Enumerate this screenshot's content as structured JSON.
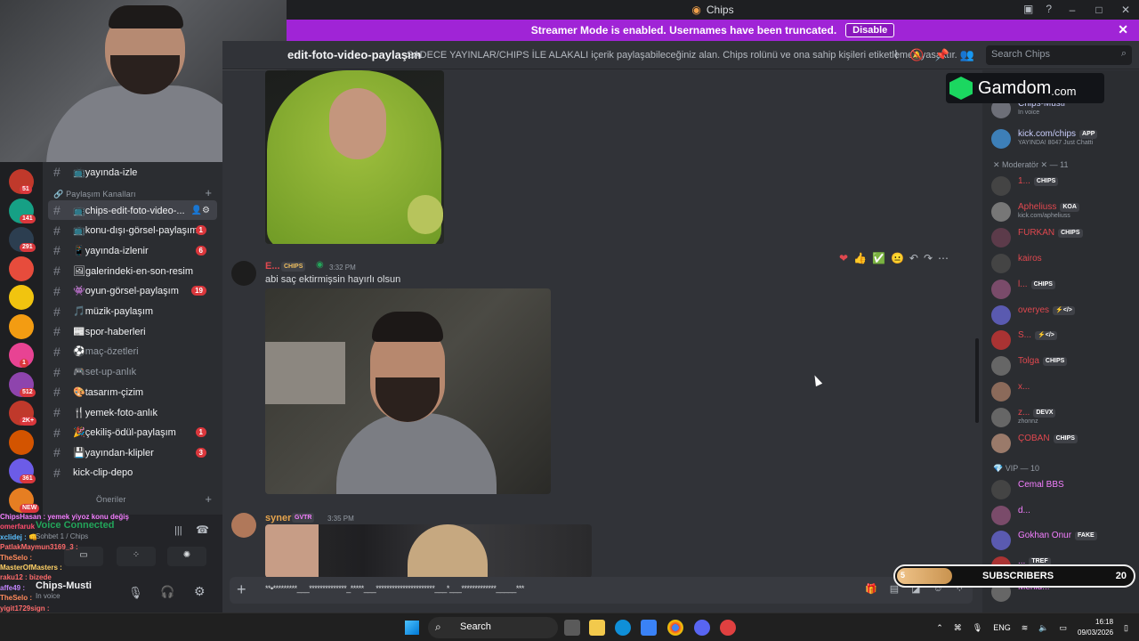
{
  "window": {
    "title": "Chips"
  },
  "banner": {
    "text": "Streamer Mode is enabled. Usernames have been truncated.",
    "disable_label": "Disable"
  },
  "header": {
    "channel_name": "edit-foto-video-paylaşım",
    "topic": "SADECE YAYINLAR/CHIPS İLE ALAKALI içerik paylaşabileceğiniz alan. Chips rolünü ve ona sahip kişileri etiketlemek yasaktır.",
    "search_placeholder": "Search Chips"
  },
  "servers": [
    {
      "badge": "51",
      "color": "#c0392b"
    },
    {
      "badge": "141",
      "color": "#16a085"
    },
    {
      "badge": "291",
      "color": "#2c3e50"
    },
    {
      "badge": "",
      "color": "#e74c3c"
    },
    {
      "badge": "",
      "color": "#f1c40f"
    },
    {
      "badge": "",
      "color": "#f39c12"
    },
    {
      "badge": "1",
      "color": "#e84393"
    },
    {
      "badge": "512",
      "color": "#8e44ad"
    },
    {
      "badge": "2K+",
      "color": "#c0392b"
    },
    {
      "badge": "",
      "color": "#d35400"
    },
    {
      "badge": "361",
      "color": "#6c5ce7"
    },
    {
      "badge": "NEW",
      "color": "#e67e22"
    }
  ],
  "channels": {
    "top_item": "📺yayında-izle",
    "category": "🔗 Paylaşım Kanalları",
    "items": [
      {
        "label": "📺chips-edit-foto-video-...",
        "count": "",
        "state": "sel"
      },
      {
        "label": "📺konu-dışı-görsel-paylaşım",
        "count": "1",
        "state": "unread"
      },
      {
        "label": "📱yayında-izlenir",
        "count": "6",
        "state": "unread"
      },
      {
        "label": "🖼galerindeki-en-son-resim",
        "count": "",
        "state": "unread"
      },
      {
        "label": "👾oyun-görsel-paylaşım",
        "count": "19",
        "state": "unread"
      },
      {
        "label": "🎵müzik-paylaşım",
        "count": "",
        "state": "unread"
      },
      {
        "label": "📰spor-haberleri",
        "count": "",
        "state": "unread"
      },
      {
        "label": "⚽maç-özetleri",
        "count": "",
        "state": "read"
      },
      {
        "label": "🎮set-up-anlık",
        "count": "",
        "state": "read"
      },
      {
        "label": "🎨tasarım-çizim",
        "count": "",
        "state": "unread"
      },
      {
        "label": "🍴yemek-foto-anlık",
        "count": "",
        "state": "unread"
      },
      {
        "label": "🎉çekiliş-ödül-paylaşım",
        "count": "1",
        "state": "unread"
      },
      {
        "label": "💾yayından-klipler",
        "count": "3",
        "state": "unread"
      },
      {
        "label": "kick-clip-depo",
        "count": "",
        "state": "unread"
      }
    ],
    "category2": "Öneriler"
  },
  "voice": {
    "status": "Voice Connected",
    "channel": "Sohbet 1 / Chips",
    "user": "Chips-Musti",
    "user_status": "In voice"
  },
  "chat_overlay": [
    "ChipsHasan : yemek yiyoz konu değiş",
    "omerfaruk",
    "xclidej : 👊",
    "PatlakMaymun3169_3 :",
    "TheSelo :",
    "MasterOfMasters :",
    "raku12 : bizede",
    "affe49 :",
    "TheSelo :",
    "yigit1729sign :"
  ],
  "messages": [
    {
      "user": "E...",
      "tag": "CHIPS",
      "time": "3:32 PM",
      "text": "abi saç ektirmişsin hayırlı olsun"
    },
    {
      "user": "syner",
      "tag": "GVTR",
      "time": "3:35 PM",
      "text": ""
    }
  ],
  "reactions": [
    "❤",
    "👍",
    "✅",
    "😐",
    "↶",
    "↷",
    "⋯"
  ],
  "composer": {
    "text": "**•*********___**************_*****___**********************___*___*************_____***"
  },
  "members": {
    "voice": [
      {
        "name": "Chips-Musti",
        "status": "In voice",
        "color": "#c9cdfb"
      },
      {
        "name": "kick.com/chips",
        "tag": "APP",
        "status": "YAYINDA! 8047 Just Chatti",
        "color": "#c9cdfb"
      }
    ],
    "mod_header": "✕ Moderatör ✕ — 11",
    "mods": [
      {
        "name": "1...",
        "tag": "CHIPS",
        "status": "",
        "color": "#e0484f"
      },
      {
        "name": "Apheliuss",
        "tag": "KOA",
        "status": "kick.com/apheliuss",
        "color": "#e0484f"
      },
      {
        "name": "FURKAN",
        "tag": "CHIPS",
        "status": "",
        "color": "#e0484f"
      },
      {
        "name": "kairos",
        "tag": "",
        "status": "",
        "color": "#e0484f"
      },
      {
        "name": "l...",
        "tag": "CHIPS",
        "status": "",
        "color": "#e0484f"
      },
      {
        "name": "overyes",
        "tag": "⚡</>",
        "status": "",
        "color": "#e0484f"
      },
      {
        "name": "S...",
        "tag": "⚡</>",
        "status": "",
        "color": "#e0484f"
      },
      {
        "name": "Tolga",
        "tag": "CHIPS",
        "status": "",
        "color": "#e0484f"
      },
      {
        "name": "x...",
        "tag": "",
        "status": "",
        "color": "#e0484f"
      },
      {
        "name": "z...",
        "tag": "DEVX",
        "status": "zhonnz",
        "color": "#e0484f"
      },
      {
        "name": "ÇOBAN",
        "tag": "CHIPS",
        "status": "",
        "color": "#e0484f"
      }
    ],
    "vip_header": "💎 VIP — 10",
    "vips": [
      {
        "name": "Cemal BBS",
        "tag": "",
        "color": "#f47fff"
      },
      {
        "name": "d...",
        "tag": "",
        "color": "#f47fff"
      },
      {
        "name": "Gokhan Onur",
        "tag": "FAKE",
        "color": "#f47fff"
      },
      {
        "name": "...",
        "tag": "TREF",
        "color": "#f47fff"
      },
      {
        "name": "Mehid...",
        "tag": "",
        "color": "#f47fff"
      }
    ]
  },
  "gamdom": {
    "brand": "Gamdom",
    "tld": ".com"
  },
  "subs": {
    "label": "SUBSCRIBERS",
    "count": "20",
    "progress_label": "5",
    "progress": 0.25
  },
  "taskbar": {
    "search": "Search",
    "lang": "ENG",
    "time": "16:18",
    "date": "09/03/2026"
  }
}
